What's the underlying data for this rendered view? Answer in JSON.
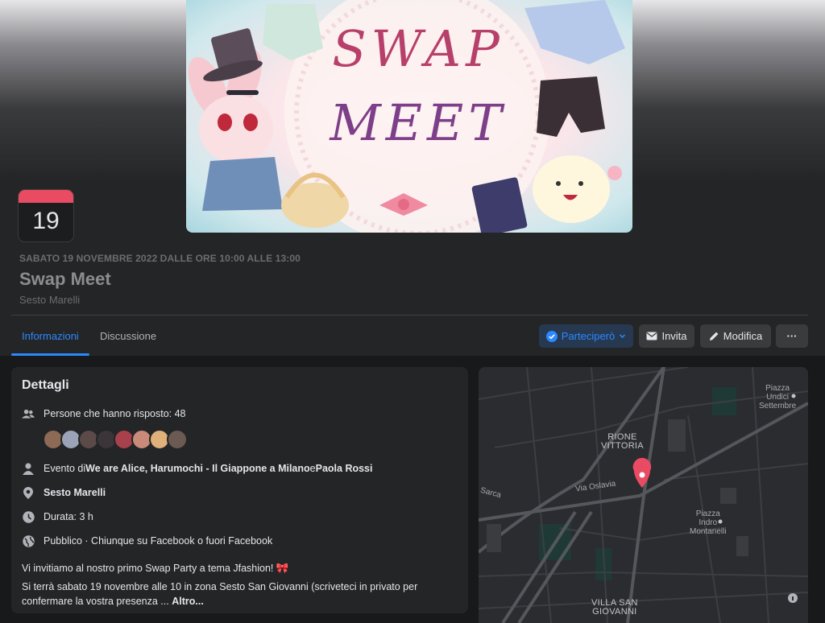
{
  "cover": {
    "title_line1": "SWAP",
    "title_line2": "MEET"
  },
  "calendar": {
    "day": "19"
  },
  "event": {
    "date_line": "SABATO 19 NOVEMBRE 2022 DALLE ORE 10:00 ALLE 13:00",
    "title": "Swap Meet",
    "location": "Sesto Marelli"
  },
  "tabs": [
    {
      "label": "Informazioni",
      "active": true
    },
    {
      "label": "Discussione",
      "active": false
    }
  ],
  "actions": {
    "going": "Parteciperò",
    "invite": "Invita",
    "edit": "Modifica",
    "more": "···"
  },
  "details": {
    "title": "Dettagli",
    "responded": "Persone che hanno risposto: 48",
    "avatar_colors": [
      "#8c6a55",
      "#9aa3b8",
      "#5b4a48",
      "#3b3438",
      "#a9414c",
      "#c98a7a",
      "#e0b07a",
      "#6b5a52"
    ],
    "organizer_prefix": "Evento di ",
    "organizer_a": "We are Alice, Harumochi - Il Giappone a Milano",
    "organizer_and": " e ",
    "organizer_b": "Paola Rossi",
    "place": "Sesto Marelli",
    "duration": "Durata: 3 h",
    "privacy": "Pubblico · Chiunque su Facebook o fuori Facebook",
    "desc1": "Vi invitiamo al nostro primo Swap Party a tema Jfashion! 🎀",
    "desc2": "Si terrà sabato 19 novembre alle 10 in zona Sesto San Giovanni (scriveteci in privato per confermare la vostra presenza ...",
    "more": "Altro..."
  },
  "map": {
    "labels": {
      "piazza_undici_l1": "Piazza",
      "piazza_undici_l2": "Undici",
      "piazza_undici_l3": "Settembre",
      "rione_l1": "RIONE",
      "rione_l2": "VITTORIA",
      "via_oslavia": "Via Oslavia",
      "sarca": "Sarca",
      "piazza_indro_l1": "Piazza",
      "piazza_indro_l2": "Indro",
      "piazza_indro_l3": "Montanelli",
      "villa_l1": "VILLA SAN",
      "villa_l2": "GIOVANNI"
    },
    "colors": {
      "pin": "#e94b63",
      "road": "#55575c",
      "park": "#1f3a36"
    }
  }
}
